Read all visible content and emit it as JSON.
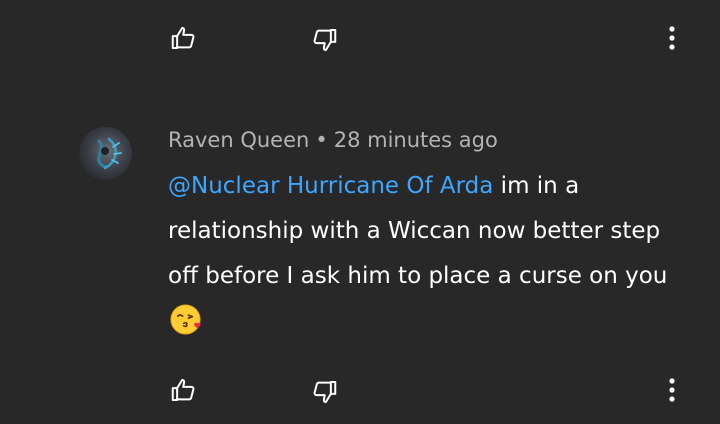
{
  "colors": {
    "background": "#282828",
    "text": "#ffffff",
    "meta_text": "#b3b3b3",
    "mention": "#3ea6ff"
  },
  "icons": {
    "like": "thumbs-up-icon",
    "dislike": "thumbs-down-icon",
    "more": "more-vert-icon",
    "emoji": "face-blowing-a-kiss-emoji"
  },
  "comment": {
    "author": "Raven Queen",
    "separator": "•",
    "time": "28 minutes ago",
    "mention": "@Nuclear Hurricane Of Arda",
    "text": " im in a relationship with a Wiccan now better step off before I ask him to place a curse on you"
  }
}
